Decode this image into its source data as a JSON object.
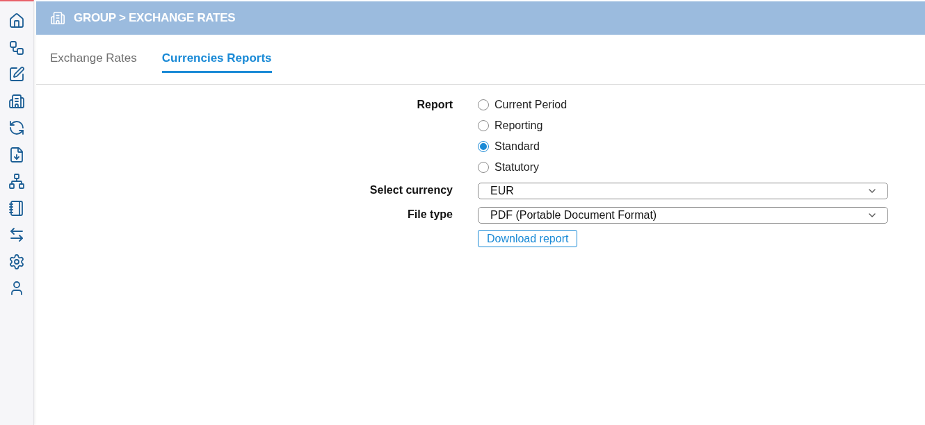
{
  "header": {
    "title": "GROUP > EXCHANGE RATES"
  },
  "tabs": [
    {
      "label": "Exchange Rates",
      "selected": false
    },
    {
      "label": "Currencies Reports",
      "selected": true
    }
  ],
  "form": {
    "report": {
      "label": "Report",
      "options": [
        {
          "label": "Current Period",
          "selected": false
        },
        {
          "label": "Reporting",
          "selected": false
        },
        {
          "label": "Standard",
          "selected": true
        },
        {
          "label": "Statutory",
          "selected": false
        }
      ]
    },
    "currency": {
      "label": "Select currency",
      "value": "EUR"
    },
    "file_type": {
      "label": "File type",
      "value": "PDF (Portable Document Format)"
    },
    "download_button": "Download report"
  }
}
